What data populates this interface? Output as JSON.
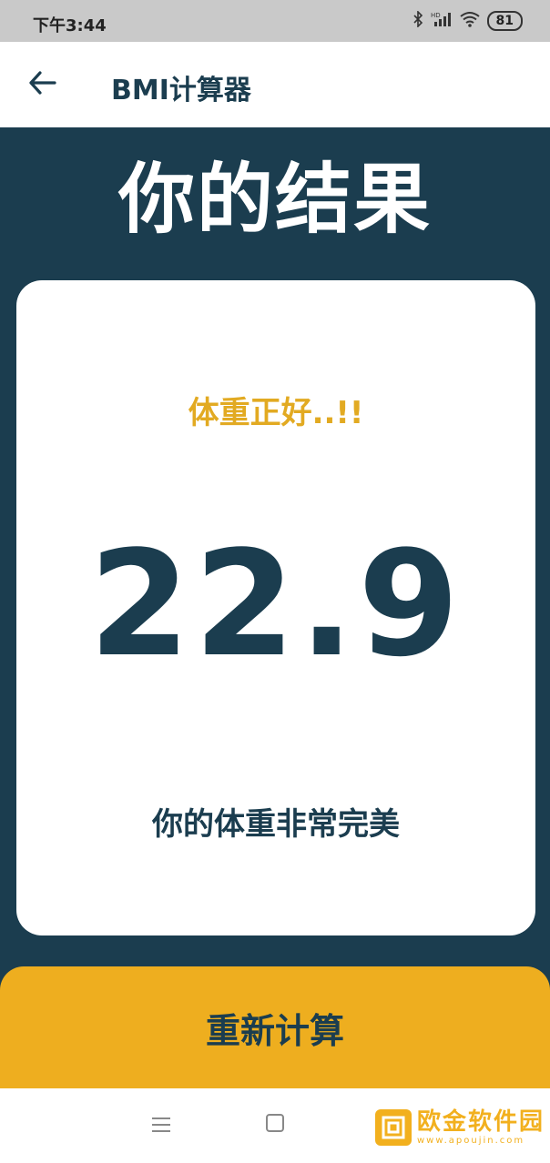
{
  "status_bar": {
    "time": "下午3:44",
    "battery": "81",
    "icons": [
      "bluetooth-icon",
      "hd-signal-icon",
      "wifi-icon",
      "battery-icon"
    ]
  },
  "app_bar": {
    "back_icon": "arrow-left-icon",
    "title": "BMI计算器"
  },
  "main": {
    "page_title": "你的结果",
    "result_card": {
      "status": "体重正好..!!",
      "bmi": "22.9",
      "message": "你的体重非常完美"
    },
    "recalculate_label": "重新计算"
  },
  "nav_bar": {
    "icons": [
      "menu-icon",
      "home-icon"
    ]
  },
  "watermark": {
    "text": "欧金软件园",
    "sub": "www.apoujin.com"
  },
  "colors": {
    "primary_dark": "#1b3d4f",
    "accent_yellow": "#eeae1f",
    "status_orange": "#e2aa22",
    "card_bg": "#ffffff"
  }
}
